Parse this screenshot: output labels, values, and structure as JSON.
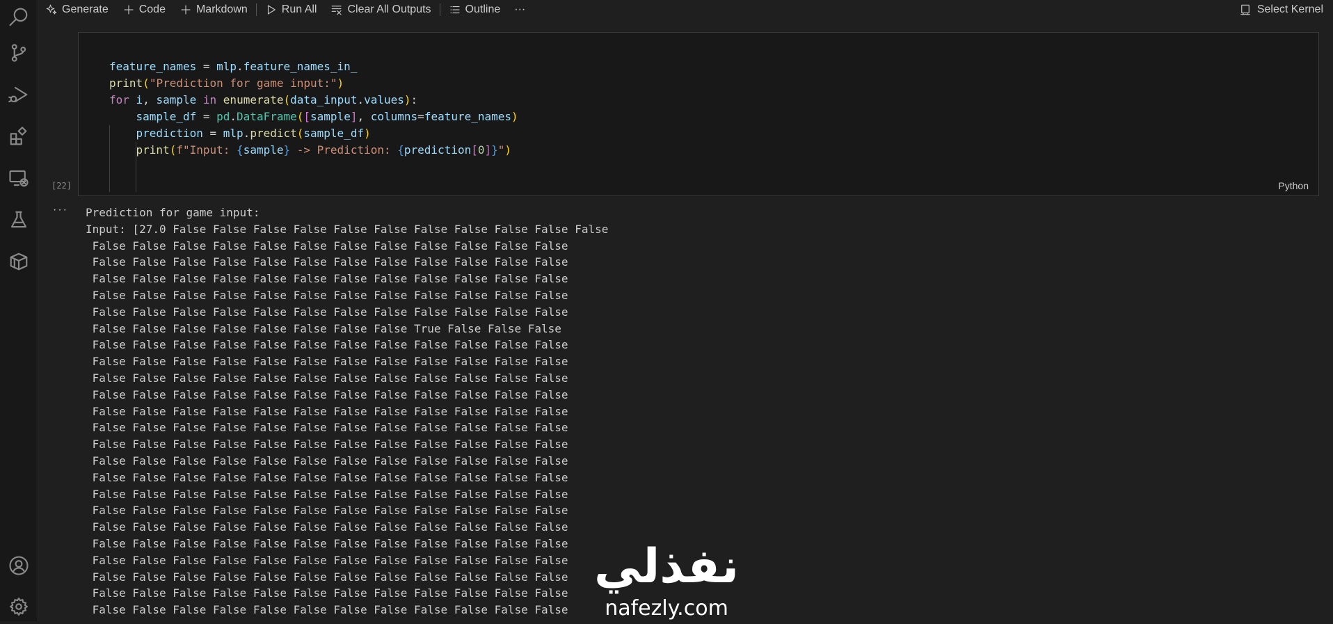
{
  "toolbar": {
    "generate": "Generate",
    "code": "Code",
    "markdown": "Markdown",
    "run_all": "Run All",
    "clear_all": "Clear All Outputs",
    "outline": "Outline",
    "more": "···",
    "select_kernel": "Select Kernel"
  },
  "activity_bar": [
    "search-icon",
    "source-control-icon",
    "run-debug-icon",
    "extensions-icon",
    "remote-explorer-icon",
    "testing-icon",
    "packages-icon",
    "accounts-icon",
    "manage-gear-icon"
  ],
  "cell": {
    "execution_count": "[22]",
    "language": "Python",
    "code": {
      "l1": {
        "t1": "feature_names",
        "t2": " = ",
        "t3": "mlp",
        "t4": ".",
        "t5": "feature_names_in_"
      },
      "l2": {
        "t1": "print",
        "t2": "(",
        "t3": "\"Prediction for game input:\"",
        "t4": ")"
      },
      "l3": {
        "t1": "for",
        "t2": " ",
        "t3": "i",
        "t4": ", ",
        "t5": "sample",
        "t6": " ",
        "t7": "in",
        "t8": " ",
        "t9": "enumerate",
        "t10": "(",
        "t11": "data_input",
        "t12": ".",
        "t13": "values",
        "t14": ")",
        "t15": ":"
      },
      "l4": {
        "t1": "sample_df",
        "t2": " = ",
        "t3": "pd",
        "t4": ".",
        "t5": "DataFrame",
        "t6": "(",
        "t7": "[",
        "t8": "sample",
        "t9": "]",
        "t10": ", ",
        "t11": "columns",
        "t12": "=",
        "t13": "feature_names",
        "t14": ")"
      },
      "l5": {
        "t1": "prediction",
        "t2": " = ",
        "t3": "mlp",
        "t4": ".",
        "t5": "predict",
        "t6": "(",
        "t7": "sample_df",
        "t8": ")"
      },
      "l6": {
        "t1": "print",
        "t2": "(",
        "t3": "f\"Input: ",
        "t4": "{",
        "t5": "sample",
        "t6": "}",
        "t7": " -> Prediction: ",
        "t8": "{",
        "t9": "prediction",
        "t10": "[",
        "t11": "0",
        "t12": "]",
        "t13": "}",
        "t14": "\"",
        "t15": ")"
      }
    }
  },
  "output": {
    "more": "···",
    "lines": [
      "Prediction for game input:",
      "Input: [27.0 False False False False False False False False False False False",
      " False False False False False False False False False False False False",
      " False False False False False False False False False False False False",
      " False False False False False False False False False False False False",
      " False False False False False False False False False False False False",
      " False False False False False False False False False False False False",
      " False False False False False False False False True False False False",
      " False False False False False False False False False False False False",
      " False False False False False False False False False False False False",
      " False False False False False False False False False False False False",
      " False False False False False False False False False False False False",
      " False False False False False False False False False False False False",
      " False False False False False False False False False False False False",
      " False False False False False False False False False False False False",
      " False False False False False False False False False False False False",
      " False False False False False False False False False False False False",
      " False False False False False False False False False False False False",
      " False False False False False False False False False False False False",
      " False False False False False False False False False False False False",
      " False False False False False False False False False False False False",
      " False False False False False False False False False False False False",
      " False False False False False False False False False False False False",
      " False False False False False False False False False False False False",
      " False False False False False False False False False False False False"
    ]
  },
  "watermark": {
    "arabic": "نفذلي",
    "latin": "nafezly.com"
  }
}
